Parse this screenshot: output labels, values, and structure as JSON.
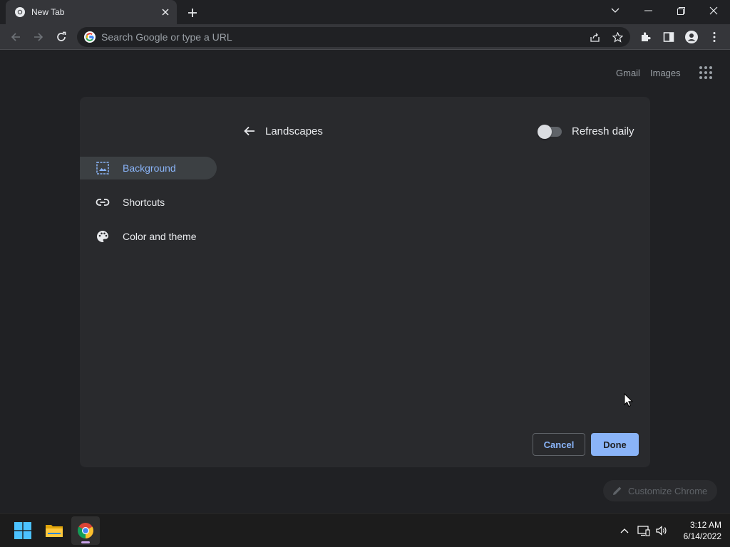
{
  "tab": {
    "title": "New Tab"
  },
  "omnibox": {
    "placeholder": "Search Google or type a URL"
  },
  "ntp_links": {
    "gmail": "Gmail",
    "images": "Images"
  },
  "dialog": {
    "sidebar": [
      {
        "label": "Background",
        "icon": "image-icon",
        "selected": true
      },
      {
        "label": "Shortcuts",
        "icon": "link-icon",
        "selected": false
      },
      {
        "label": "Color and theme",
        "icon": "palette-icon",
        "selected": false
      }
    ],
    "collection_title": "Landscapes",
    "refresh_daily_label": "Refresh daily",
    "refresh_daily_on": false,
    "cancel_label": "Cancel",
    "done_label": "Done"
  },
  "customize_chip": {
    "label": "Customize Chrome"
  },
  "taskbar": {
    "apps": [
      "start-icon",
      "file-explorer-icon",
      "chrome-icon"
    ],
    "time": "3:12 AM",
    "date": "6/14/2022"
  },
  "colors": {
    "accent": "#8ab4f8",
    "background": "#202124",
    "dialog": "#292a2d"
  }
}
